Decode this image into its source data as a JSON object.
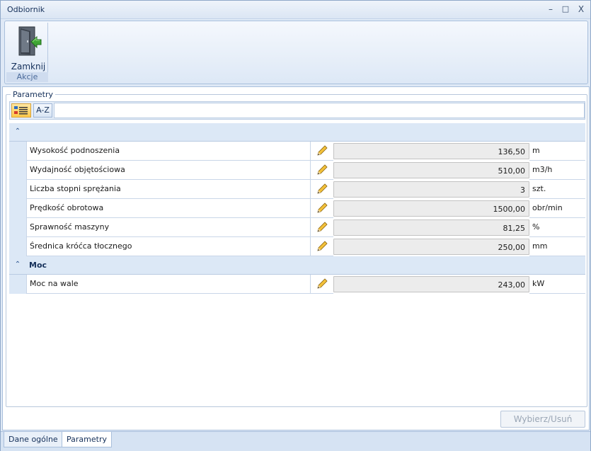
{
  "window": {
    "title": "Odbiornik",
    "controls": {
      "minimize": "–",
      "maximize": "□",
      "close": "X"
    }
  },
  "ribbon": {
    "close_button_label": "Zamknij",
    "group_label": "Akcje"
  },
  "parameters": {
    "legend": "Parametry",
    "toolbar": {
      "az_label": "A-Z",
      "search_value": ""
    },
    "categories": [
      {
        "title": "",
        "properties": [
          {
            "name": "Wysokość podnoszenia",
            "value": "136,50",
            "unit": "m"
          },
          {
            "name": "Wydajność objętościowa",
            "value": "510,00",
            "unit": "m3/h"
          },
          {
            "name": "Liczba stopni sprężania",
            "value": "3",
            "unit": "szt."
          },
          {
            "name": "Prędkość obrotowa",
            "value": "1500,00",
            "unit": "obr/min"
          },
          {
            "name": "Sprawność maszyny",
            "value": "81,25",
            "unit": "%"
          },
          {
            "name": "Średnica króćca tłocznego",
            "value": "250,00",
            "unit": "mm"
          }
        ]
      },
      {
        "title": "Moc",
        "properties": [
          {
            "name": "Moc na wale",
            "value": "243,00",
            "unit": "kW"
          }
        ]
      }
    ]
  },
  "footer": {
    "select_remove_label": "Wybierz/Usuń"
  },
  "tabs": [
    {
      "label": "Dane ogólne",
      "active": false
    },
    {
      "label": "Parametry",
      "active": true
    }
  ]
}
